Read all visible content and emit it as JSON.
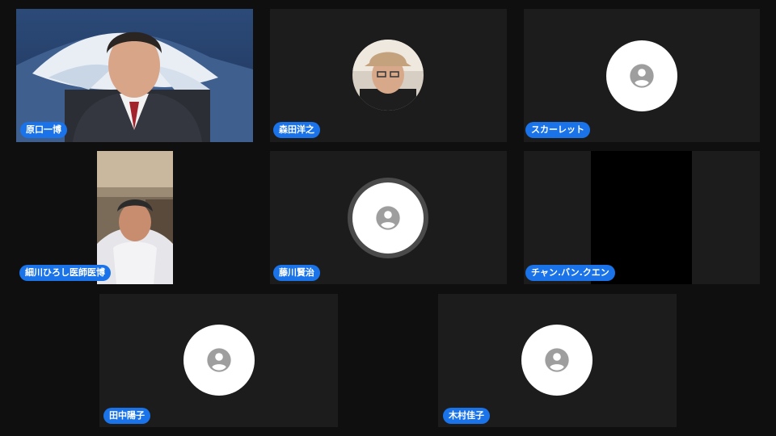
{
  "participants": [
    {
      "name": "原口一博",
      "has_video": true,
      "video": "man-suit-mountain-background"
    },
    {
      "name": "森田洋之",
      "has_video": true,
      "video": "round-photo-avatar"
    },
    {
      "name": "スカーレット",
      "has_video": false
    },
    {
      "name": "細川ひろし医師医博",
      "has_video": true,
      "video": "man-towel-room"
    },
    {
      "name": "藤川賢治",
      "has_video": false,
      "speaking": true
    },
    {
      "name": "チャン.バン.クエン",
      "has_video": true,
      "video": "black-screen"
    },
    {
      "name": "田中陽子",
      "has_video": false
    },
    {
      "name": "木村佳子",
      "has_video": false
    }
  ],
  "colors": {
    "background": "#0f0f0f",
    "tile": "#1c1c1c",
    "name_tag": "#1a73e8",
    "avatar_bg": "#ffffff",
    "avatar_icon": "#9e9e9e"
  },
  "icons": {
    "placeholder_avatar": "person-circle-icon"
  }
}
